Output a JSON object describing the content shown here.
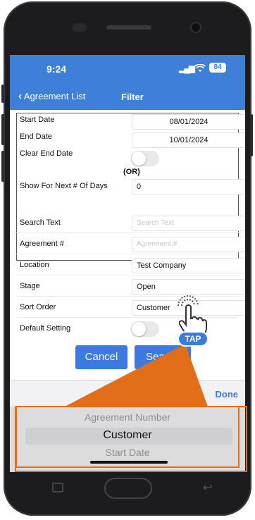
{
  "status_bar": {
    "time": "9:24",
    "signal": "▐▐▐",
    "battery": "84"
  },
  "nav": {
    "back_label": "Agreement List",
    "title": "Filter"
  },
  "dates": {
    "start_label": "Start Date",
    "start_value": "08/01/2024",
    "end_label": "End Date",
    "end_value": "10/01/2024",
    "clear_label": "Clear End Date",
    "or_label": "(OR)",
    "days_label": "Show For Next # Of Days",
    "days_value": "0"
  },
  "filters": {
    "search_label": "Search Text",
    "search_placeholder": "Search Text",
    "agreement_label": "Agreement #",
    "agreement_placeholder": "Agreement #",
    "location_label": "Location",
    "location_value": "Test Company",
    "stage_label": "Stage",
    "stage_value": "Open",
    "sort_label": "Sort Order",
    "sort_value": "Customer",
    "default_label": "Default Setting"
  },
  "buttons": {
    "cancel": "Cancel",
    "search": "Searc"
  },
  "annotation": {
    "tap": "TAP"
  },
  "picker": {
    "done_label": "Done",
    "options": [
      "Agreement Number",
      "Customer",
      "Start Date"
    ],
    "selected": "Customer"
  },
  "colors": {
    "accent": "#3b7ae0",
    "annotation": "#e36e1a",
    "nav": "#3d7fd9"
  }
}
